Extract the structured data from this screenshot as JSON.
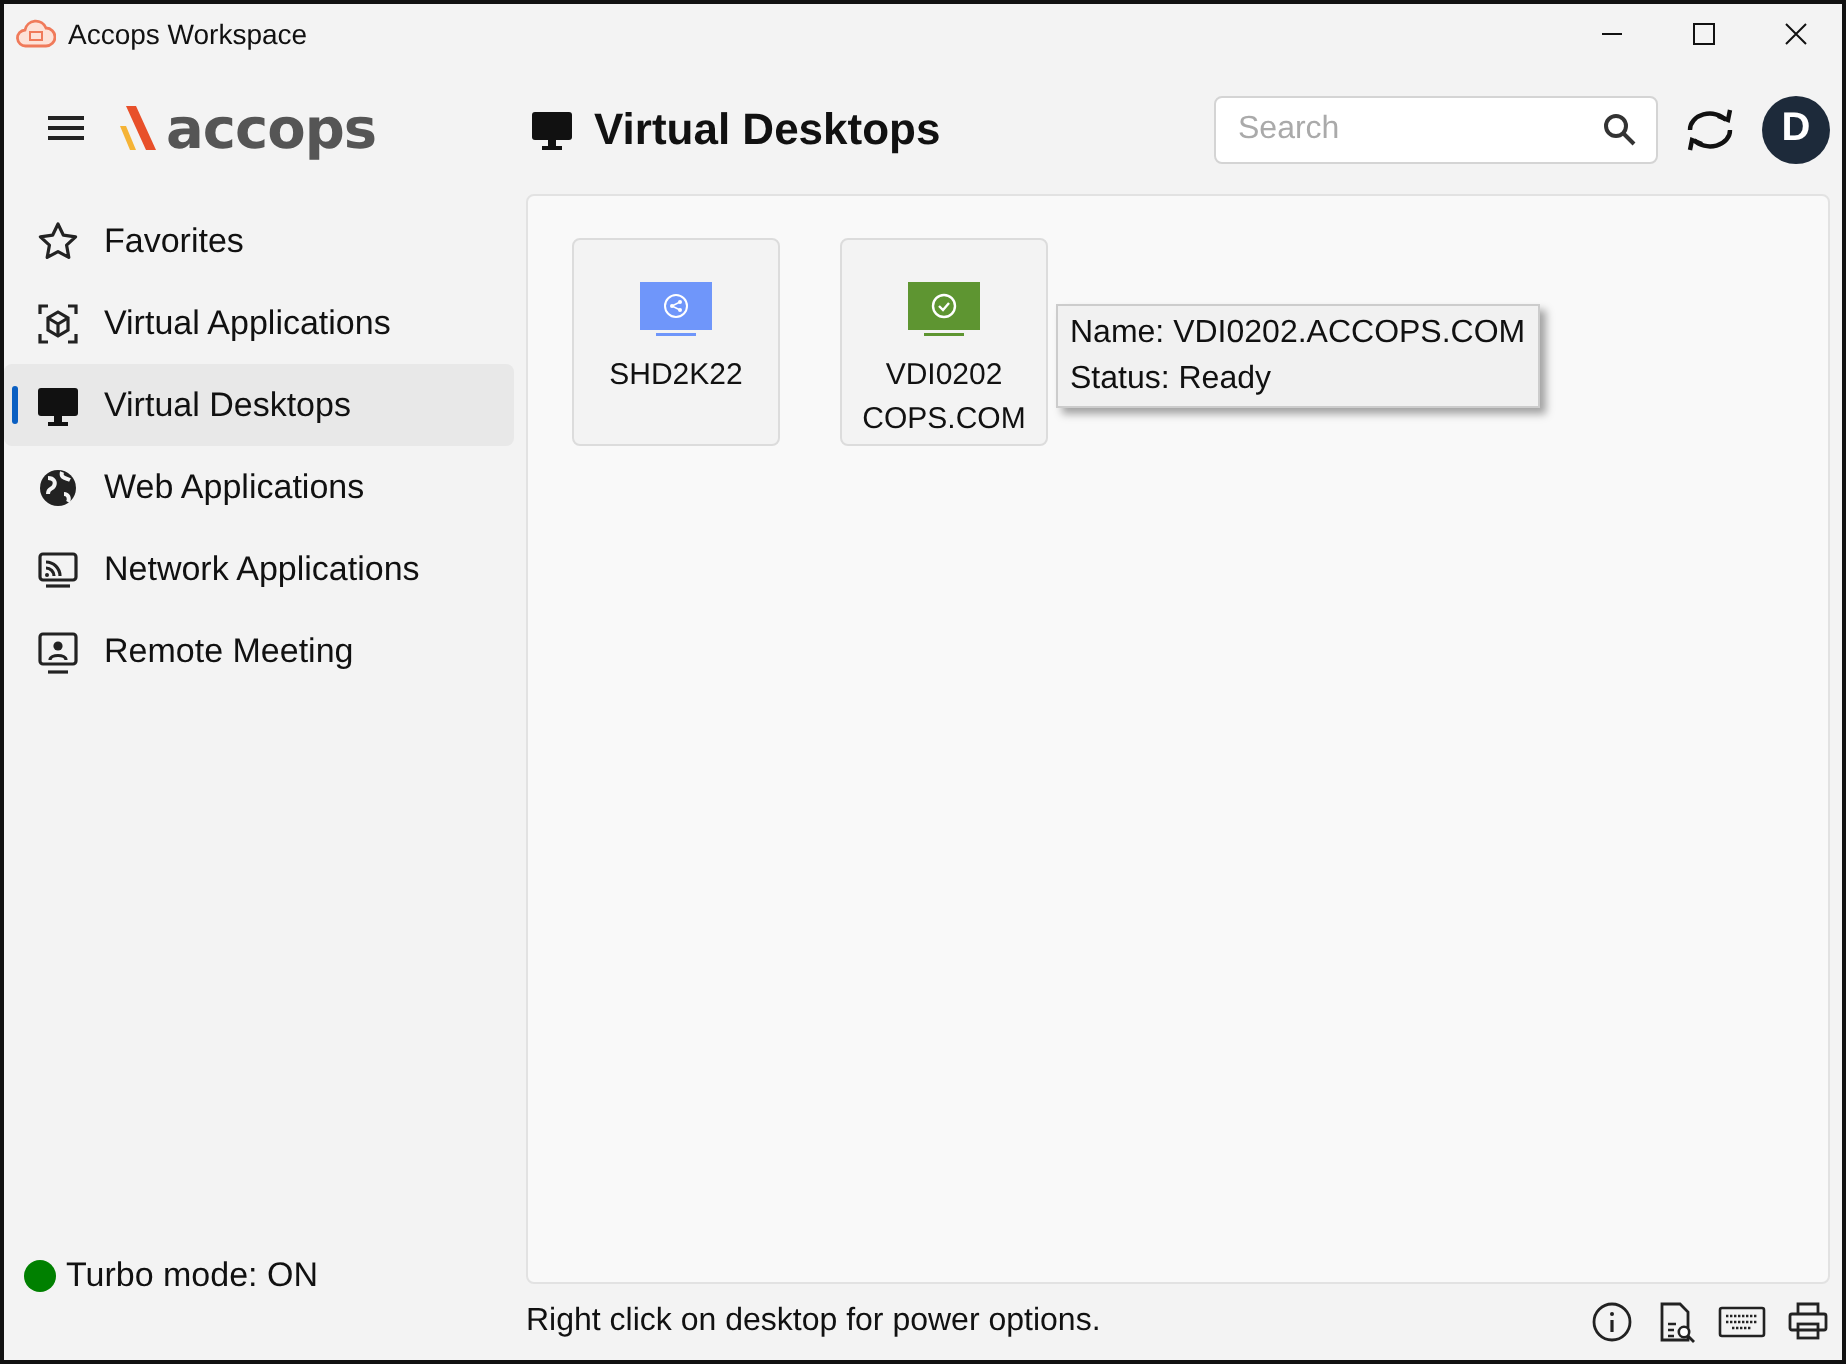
{
  "window": {
    "title": "Accops Workspace"
  },
  "logo": {
    "text": "accops"
  },
  "sidebar": {
    "items": [
      {
        "label": "Favorites",
        "selected": false
      },
      {
        "label": "Virtual Applications",
        "selected": false
      },
      {
        "label": "Virtual Desktops",
        "selected": true
      },
      {
        "label": "Web Applications",
        "selected": false
      },
      {
        "label": "Network Applications",
        "selected": false
      },
      {
        "label": "Remote Meeting",
        "selected": false
      }
    ]
  },
  "turbo": {
    "label": "Turbo mode: ON",
    "color": "#008000"
  },
  "header": {
    "title": "Virtual Desktops",
    "search": {
      "placeholder": "Search"
    },
    "avatar": "D"
  },
  "desktops": [
    {
      "label_lines": [
        "SHD2K22"
      ],
      "kind": "shared",
      "color": "#6f96fa"
    },
    {
      "label_lines": [
        "VDI0202",
        "COPS.COM"
      ],
      "kind": "ready",
      "color": "#5e9531"
    }
  ],
  "tooltip": {
    "lines": [
      "Name: VDI0202.ACCOPS.COM",
      "Status: Ready"
    ]
  },
  "status_bar": {
    "text": "Right click on desktop for power options."
  }
}
